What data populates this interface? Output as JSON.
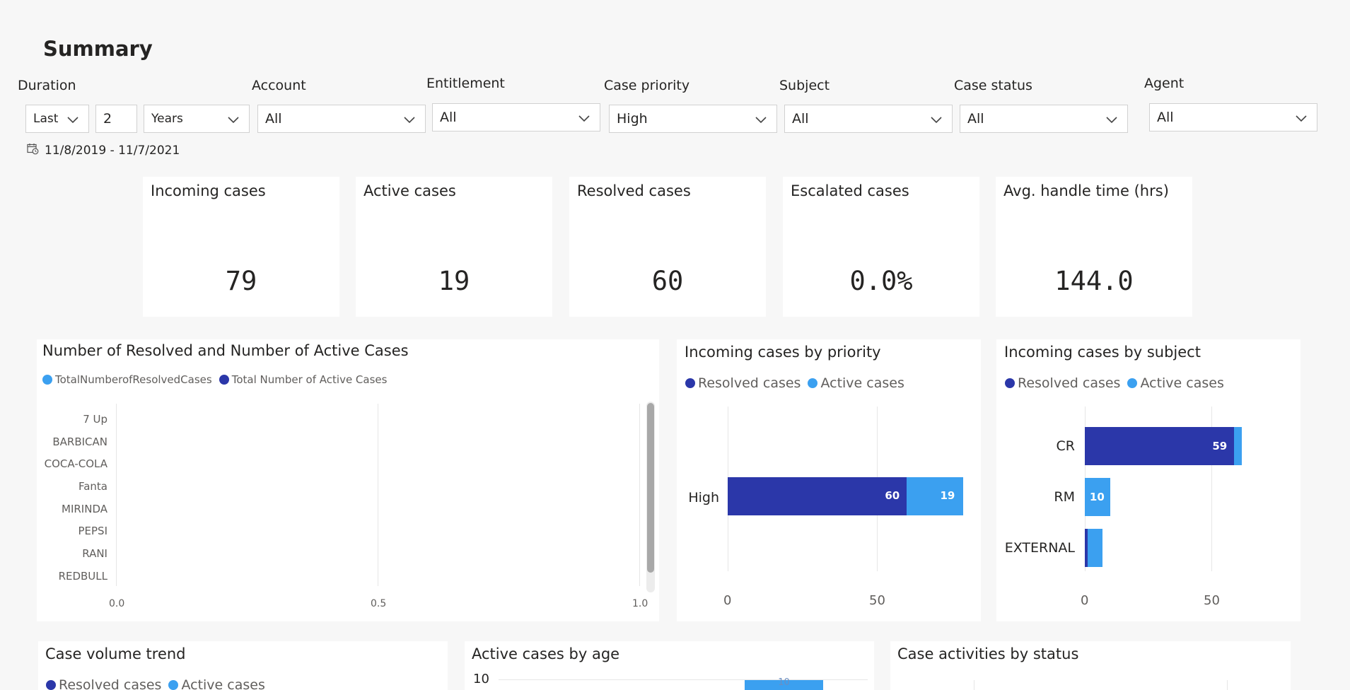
{
  "page": {
    "title": "Summary"
  },
  "filters": {
    "duration": {
      "label": "Duration",
      "mode": "Last",
      "count": "2",
      "unit": "Years"
    },
    "account": {
      "label": "Account",
      "value": "All"
    },
    "entitlement": {
      "label": "Entitlement",
      "value": "All"
    },
    "case_priority": {
      "label": "Case priority",
      "value": "High"
    },
    "subject": {
      "label": "Subject",
      "value": "All"
    },
    "case_status": {
      "label": "Case status",
      "value": "All"
    },
    "agent": {
      "label": "Agent",
      "value": "All"
    },
    "date_range": "11/8/2019 - 11/7/2021"
  },
  "kpis": [
    {
      "title": "Incoming cases",
      "value": "79"
    },
    {
      "title": "Active cases",
      "value": "19"
    },
    {
      "title": "Resolved cases",
      "value": "60"
    },
    {
      "title": "Escalated cases",
      "value": "0.0%"
    },
    {
      "title": "Avg. handle time (hrs)",
      "value": "144.0"
    }
  ],
  "colors": {
    "resolved": "#2b37a9",
    "active": "#3ba0f0",
    "grid": "#e6e6e6"
  },
  "chart_data": [
    {
      "type": "bar",
      "orientation": "horizontal",
      "title": "Number of Resolved and Number of Active Cases",
      "legend": [
        "TotalNumberofResolvedCases",
        "Total Number of Active Cases"
      ],
      "categories": [
        "7 Up",
        "BARBICAN",
        "COCA-COLA",
        "Fanta",
        "MIRINDA",
        "PEPSI",
        "RANI",
        "REDBULL"
      ],
      "x_ticks": [
        "0.0",
        "0.5",
        "1.0"
      ],
      "xlim": [
        0,
        1
      ],
      "series": []
    },
    {
      "type": "bar",
      "orientation": "horizontal",
      "stacked": true,
      "title": "Incoming cases by priority",
      "legend": [
        "Resolved cases",
        "Active cases"
      ],
      "categories": [
        "High"
      ],
      "series": [
        {
          "name": "Resolved cases",
          "values": [
            60
          ]
        },
        {
          "name": "Active cases",
          "values": [
            19
          ]
        }
      ],
      "x_ticks": [
        "0",
        "50"
      ],
      "xlim": [
        0,
        79
      ]
    },
    {
      "type": "bar",
      "orientation": "horizontal",
      "stacked": true,
      "title": "Incoming cases by subject",
      "legend": [
        "Resolved cases",
        "Active cases"
      ],
      "categories": [
        "CR",
        "RM",
        "EXTERNAL"
      ],
      "series": [
        {
          "name": "Resolved cases",
          "values": [
            59,
            0,
            1
          ]
        },
        {
          "name": "Active cases",
          "values": [
            3,
            10,
            6
          ]
        }
      ],
      "value_labels": [
        "59",
        "10",
        ""
      ],
      "x_ticks": [
        "0",
        "50"
      ],
      "xlim": [
        0,
        51
      ]
    }
  ],
  "bottom_cards": [
    {
      "title": "Case volume trend",
      "legend": [
        "Resolved cases",
        "Active cases"
      ]
    },
    {
      "title": "Active cases by age",
      "y_tick": "10",
      "bar_label": "10"
    },
    {
      "title": "Case activities by status"
    }
  ]
}
